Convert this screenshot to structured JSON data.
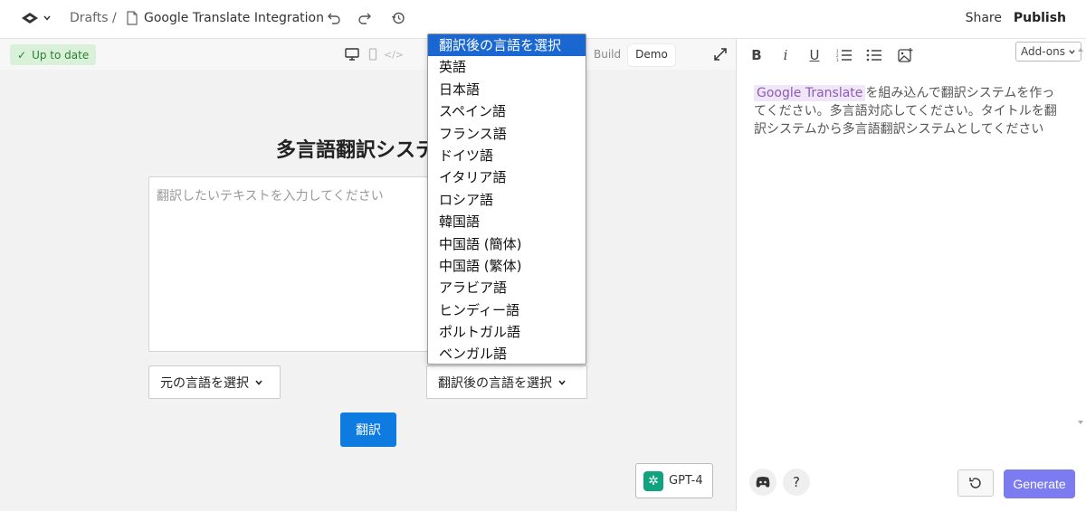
{
  "topbar": {
    "drafts": "Drafts",
    "separator": "/",
    "doc_title": "Google Translate Integration",
    "share": "Share",
    "publish": "Publish"
  },
  "preview": {
    "status": "Up to date",
    "modes": [
      "Build",
      "Demo"
    ],
    "app_title": "多言語翻訳システム",
    "textarea_placeholder": "翻訳したいテキストを入力してください",
    "source_select": "元の言語を選択",
    "target_select": "翻訳後の言語を選択",
    "translate_button": "翻訳",
    "model": "GPT-4"
  },
  "dropdown": {
    "options": [
      "翻訳後の言語を選択",
      "英語",
      "日本語",
      "スペイン語",
      "フランス語",
      "ドイツ語",
      "イタリア語",
      "ロシア語",
      "韓国語",
      "中国語 (簡体)",
      "中国語 (繁体)",
      "アラビア語",
      "ヒンディー語",
      "ポルトガル語",
      "ベンガル語"
    ]
  },
  "editor": {
    "addons": "Add-ons",
    "tag": "Google Translate",
    "prompt_text": "を組み込んで翻訳システムを作ってください。多言語対応してください。タイトルを翻訳システムから多言語翻訳システムとしてください",
    "help": "?",
    "generate": "Generate"
  },
  "colors": {
    "accent": "#0d7be0",
    "generate": "#7c7cf0",
    "status_bg": "#d9f0d9",
    "selected_option": "#1a67d2"
  }
}
